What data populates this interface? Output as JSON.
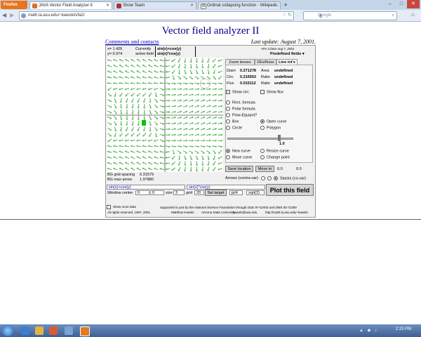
{
  "browser": {
    "firefox_label": "Firefox",
    "tabs": [
      {
        "title": "JAVA Vector Field Analyzer II",
        "active": true
      },
      {
        "title": "Show Team",
        "active": false
      },
      {
        "title": "Ordinal collapsing function - Wikiped...",
        "active": false
      }
    ],
    "url": "math.la.asu.edu/~kawski/vfa2/",
    "search_placeholder": "Google",
    "new_tab": "+",
    "back_icon": "back-arrow-icon",
    "forward_icon": "forward-arrow-icon"
  },
  "page": {
    "title": "Vector field analyzer II",
    "comments_link": "Comments and contacts",
    "last_update": "Last update: August 7, 2001."
  },
  "applet": {
    "coords": {
      "x_label": "x=",
      "x_value": "1.426",
      "y_label": "y=",
      "y_value": "0.974"
    },
    "currently_label": "Currently",
    "active_field_label": "active field",
    "field_x": "sin(x)+cos(y)",
    "field_y": "sin(x)*cos(y)",
    "version": "VFA 2.beta  Aug 7, 2001",
    "predefined_fields": "Predefined fields",
    "tabs": [
      "Zoom lenses",
      "DEs/flows",
      "Line int's"
    ],
    "stats": [
      {
        "label": "Diam",
        "value": "0.271278",
        "label2": "Area",
        "value2": "undefined"
      },
      {
        "label": "Circ",
        "value": "0.216563",
        "label2": "Ratio",
        "value2": "undefined"
      },
      {
        "label": "Flux",
        "value": "0.015112",
        "label2": "Ratio",
        "value2": "undefined"
      }
    ],
    "show_circ": "Show circ",
    "show_flux": "Show flux",
    "shape_options_left": [
      "Rect. formula",
      "Polar formula",
      "Flow-Equipot?",
      "Box",
      "Circle"
    ],
    "shape_options_right": [
      "Open curve",
      "Polygon"
    ],
    "slider_value": "1.0",
    "curve_options_left": [
      "New curve",
      "Move curve"
    ],
    "curve_options_right": [
      "Resize curve",
      "Change point"
    ],
    "save_location": "Save location",
    "move_to": "Move to",
    "move_x": "0.0",
    "move_y": "0.0",
    "arrows_label": "Arrows (contra-var)",
    "stacks_label": "Stacks (co-var)",
    "grid_spacing_label": "BG grid spacing",
    "grid_spacing_value": "0.31579",
    "max_arrow_label": "BG max arrow",
    "max_arrow_value": "1.97880",
    "input_x": "sin(x)+cos(y)",
    "input_y": "sin(x)*cos(y)",
    "window_center_label": "Window center",
    "wc_x": "0",
    "wc_y": "0",
    "size_label": "size",
    "size_value": "3",
    "grid_label": "grid",
    "grid_value": "20",
    "set_target": "Set target",
    "pi4": "pi/4",
    "sqrt2": "sqrt(2)",
    "plot_button": "Plot this field",
    "show_more": "Show more data",
    "rights": "All rights reserved, 1997, 2001.",
    "author": "Matthias Kawski",
    "university": "Arizona State University",
    "email": "kawski@asu.edu",
    "support": "Supported in part by the National Science Foundation through DUE 97-52453 and DMS 00-72369",
    "homepage": "http://math.la.asu.edu/~kawski"
  },
  "taskbar": {
    "time": "2:23 PM",
    "colors": {
      "accent": "#3d5f93",
      "field_arrows": "#3aa63a",
      "title": "#00008b"
    }
  }
}
